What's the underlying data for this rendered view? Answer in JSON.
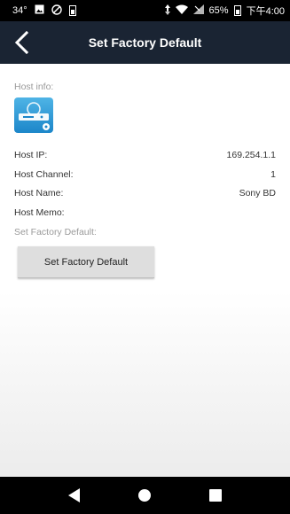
{
  "status_bar": {
    "temperature": "34°",
    "battery_percent": "65%",
    "time": "下午4:00"
  },
  "title_bar": {
    "title": "Set Factory Default"
  },
  "host_info": {
    "section_label": "Host info:",
    "rows": [
      {
        "key": "Host IP:",
        "value": "169.254.1.1"
      },
      {
        "key": "Host Channel:",
        "value": "1"
      },
      {
        "key": "Host Name:",
        "value": "Sony BD"
      },
      {
        "key": "Host Memo:",
        "value": ""
      }
    ]
  },
  "factory": {
    "section_label": "Set Factory Default:",
    "button_label": "Set Factory Default"
  },
  "colors": {
    "title_bar_bg": "#1a2433",
    "device_icon": "#2a9ad8"
  }
}
